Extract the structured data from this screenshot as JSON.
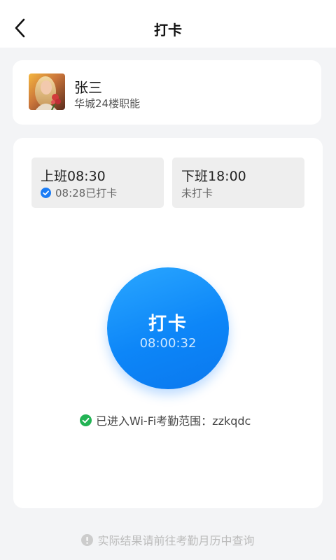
{
  "header": {
    "title": "打卡",
    "back_icon": "chevron-left-icon"
  },
  "user": {
    "name": "张三",
    "department": "华城24楼职能"
  },
  "shifts": [
    {
      "title": "上班08:30",
      "status": "08:28已打卡",
      "status_icon": "check-circle-icon",
      "status_icon_color": "#1a7cf5"
    },
    {
      "title": "下班18:00",
      "status": "未打卡"
    }
  ],
  "punch": {
    "label": "打卡",
    "time": "08:00:32",
    "color": "#1185f7"
  },
  "wifi": {
    "text": "已进入Wi-Fi考勤范围：zzkqdc",
    "icon": "check-circle-icon",
    "icon_color": "#22b354"
  },
  "footer": {
    "tip": "实际结果请前往考勤月历中查询",
    "icon": "info-circle-icon"
  }
}
